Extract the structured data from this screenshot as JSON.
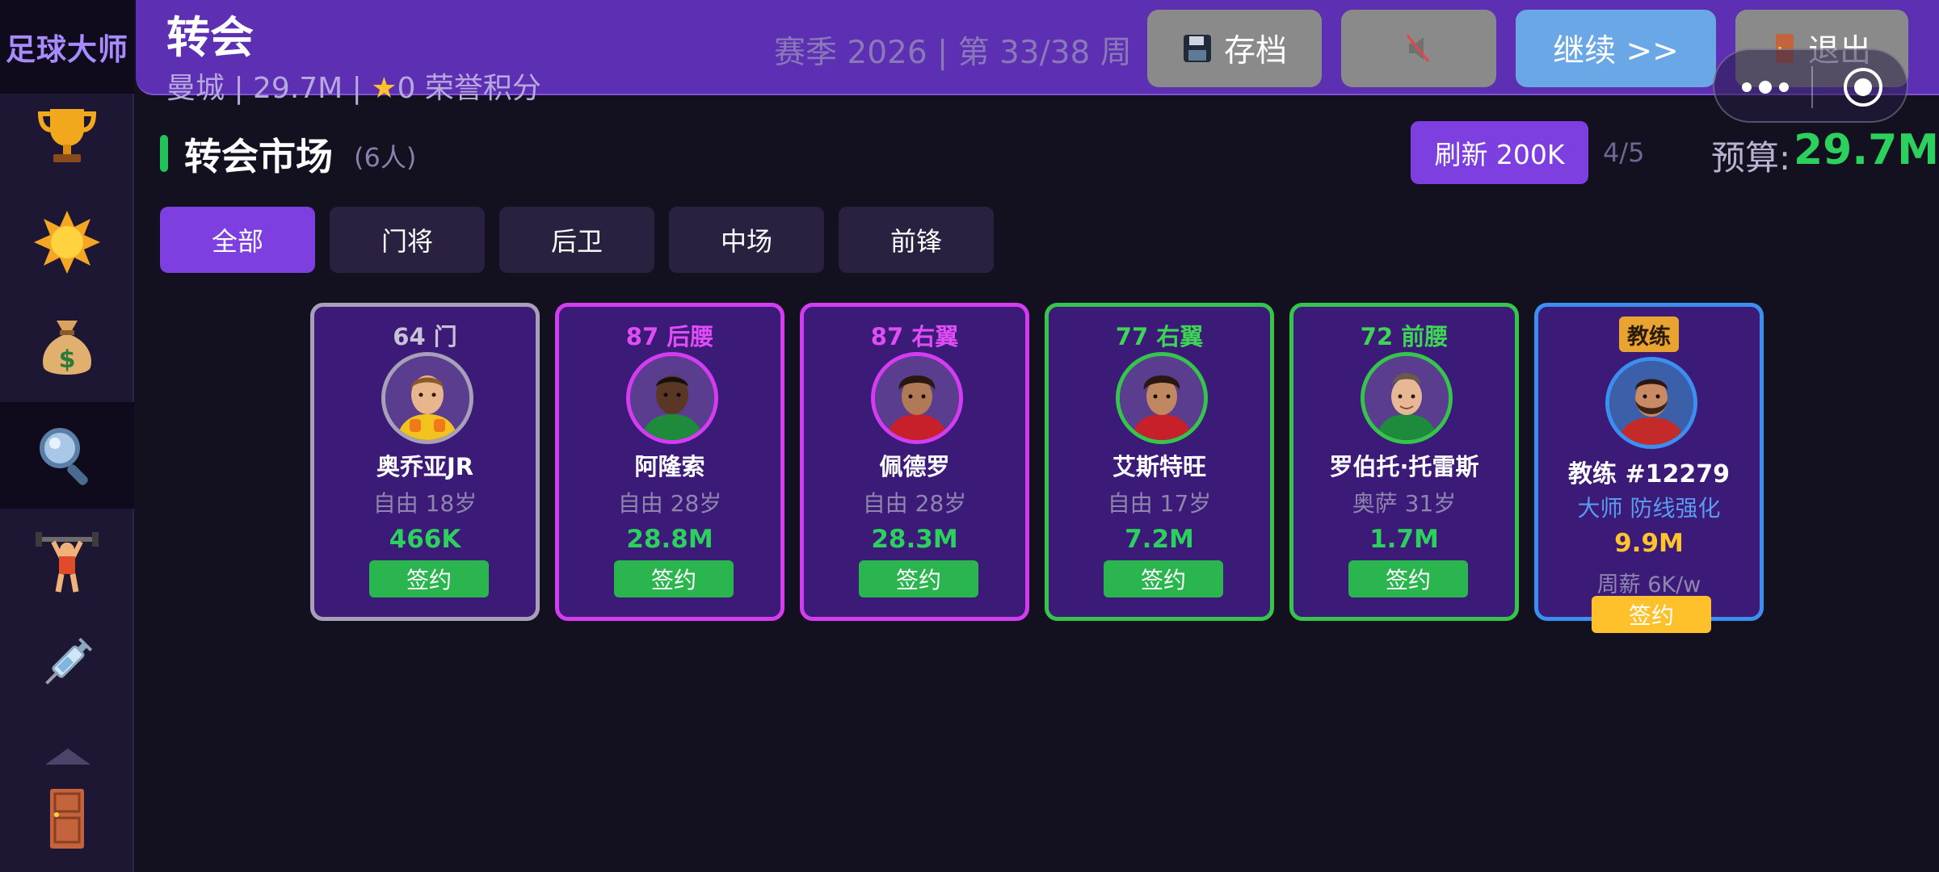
{
  "app": {
    "logo_text": "足球大师"
  },
  "sidebar": {
    "items": [
      {
        "icon": "trophy-icon"
      },
      {
        "icon": "star-icon"
      },
      {
        "icon": "money-bag-icon"
      },
      {
        "icon": "magnifier-icon",
        "active": true
      },
      {
        "icon": "weightlifter-icon"
      },
      {
        "icon": "syringe-icon"
      },
      {
        "icon": "door-icon"
      }
    ],
    "scroll_up_icon": "triangle-up-icon"
  },
  "header": {
    "title": "转会",
    "club_line_prefix": "曼城 | 29.7M | ",
    "club_line_suffix": "0 荣誉积分",
    "season": "赛季 2026 | 第 33/38 周",
    "save_label": "存档",
    "continue_label": "继续  >>",
    "exit_label": "退出"
  },
  "market": {
    "title": "转会市场",
    "count": "(6人)",
    "refresh_label": "刷新  200K",
    "refresh_count": "4/5",
    "budget_label": "预算:",
    "budget_value": "29.7M"
  },
  "tabs": [
    {
      "label": "全部",
      "active": true
    },
    {
      "label": "门将"
    },
    {
      "label": "后卫"
    },
    {
      "label": "中场"
    },
    {
      "label": "前锋"
    }
  ],
  "players": [
    {
      "rating_pos": "64 门",
      "name": "奥乔亚JR",
      "sub": "自由 18岁",
      "value": "466K",
      "sign": "签约",
      "tier": "gray",
      "head_color": "#c8c2d6"
    },
    {
      "rating_pos": "87 后腰",
      "name": "阿隆索",
      "sub": "自由 28岁",
      "value": "28.8M",
      "sign": "签约",
      "tier": "purple",
      "head_color": "#e04cf5"
    },
    {
      "rating_pos": "87 右翼",
      "name": "佩德罗",
      "sub": "自由 28岁",
      "value": "28.3M",
      "sign": "签约",
      "tier": "purple",
      "head_color": "#e04cf5"
    },
    {
      "rating_pos": "77 右翼",
      "name": "艾斯特旺",
      "sub": "自由 17岁",
      "value": "7.2M",
      "sign": "签约",
      "tier": "green",
      "head_color": "#3ed455"
    },
    {
      "rating_pos": "72 前腰",
      "name": "罗伯托·托雷斯",
      "sub": "奥萨 31岁",
      "value": "1.7M",
      "sign": "签约",
      "tier": "green",
      "head_color": "#3ed455"
    }
  ],
  "coach": {
    "badge": "教练",
    "name": "教练 #12279",
    "title": "大师 防线强化",
    "value": "9.9M",
    "wage": "周薪 6K/w",
    "sign": "签约"
  },
  "colors": {
    "accent_purple": "#7d3fe0",
    "budget_green": "#2bd05d",
    "sign_green": "#2bb54e",
    "coach_gold": "#ffc12b"
  }
}
